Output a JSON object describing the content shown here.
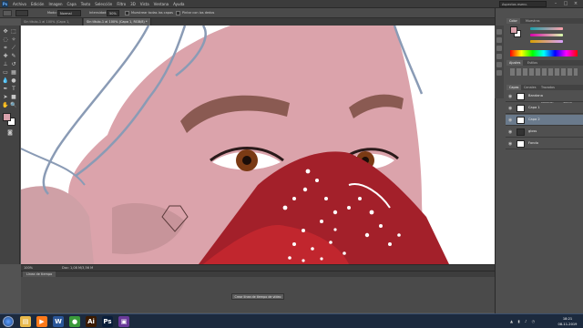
{
  "app": {
    "logo": "Ps"
  },
  "menu": {
    "items": [
      "Archivo",
      "Edición",
      "Imagen",
      "Capa",
      "Texto",
      "Selección",
      "Filtro",
      "3D",
      "Vista",
      "Ventana",
      "Ayuda"
    ],
    "workspace": "Aspectos esenc."
  },
  "options_bar": {
    "mode_label": "Modo:",
    "mode_value": "Normal",
    "intensity_label": "Intensidad:",
    "intensity_value": "50%",
    "sample_all_label": "Muestrear todas las capas",
    "finger_label": "Pintar con los dedos"
  },
  "tabs": [
    {
      "label": "Sin título-1 al 100% (Capa 1, RGB/8) *",
      "active": false
    },
    {
      "label": "Sin título-1 al 100% (Capa 1, RGB/8) *",
      "active": true
    }
  ],
  "status": {
    "zoom": "100%",
    "doc": "Doc: 1,08 M/3,56 M"
  },
  "timeline": {
    "tab": "Línea de tiempo",
    "button": "Crear línea de tiempo de vídeo"
  },
  "panels": {
    "color_tabs": [
      "Color",
      "Muestras"
    ],
    "adjust_tabs": [
      "Ajustes",
      "Estilos"
    ],
    "layer_tabs": [
      "Capas",
      "Canales",
      "Trazados"
    ],
    "blend_mode": "Normal",
    "opacity_label": "Opacidad:",
    "opacity_value": "100%",
    "fill_label": "Relleno:",
    "fill_value": "100%",
    "layers": [
      {
        "name": "Bandana",
        "selected": false
      },
      {
        "name": "Capa 1",
        "selected": false
      },
      {
        "name": "Capa 2",
        "selected": true
      },
      {
        "name": "gloss",
        "selected": false
      },
      {
        "name": "Fondo",
        "selected": false
      }
    ]
  },
  "taskbar": {
    "apps": [
      {
        "name": "explorer-icon",
        "glyph": "▤",
        "color": "#e8b84a"
      },
      {
        "name": "media-player-icon",
        "glyph": "▶",
        "color": "#ff7a1a"
      },
      {
        "name": "word-icon",
        "glyph": "W",
        "color": "#2b579a"
      },
      {
        "name": "chrome-icon",
        "glyph": "●",
        "color": "#3a9a3a"
      },
      {
        "name": "illustrator-icon",
        "glyph": "Ai",
        "color": "#3a1a00"
      },
      {
        "name": "photoshop-icon",
        "glyph": "Ps",
        "color": "#0a1e3a"
      },
      {
        "name": "video-icon",
        "glyph": "▣",
        "color": "#6a3a9a"
      }
    ],
    "time": "18:21",
    "date": "08-11-2019"
  }
}
